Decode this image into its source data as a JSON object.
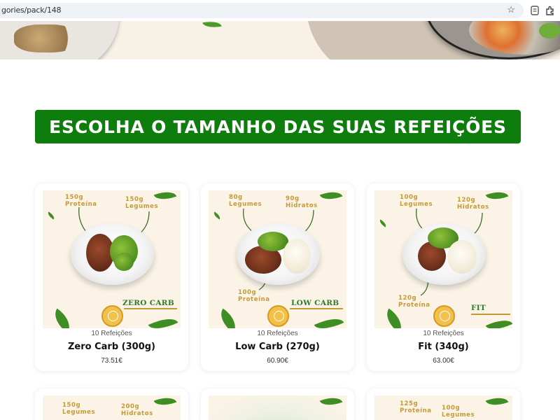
{
  "browser": {
    "url": "gories/pack/148",
    "icons": [
      "star-icon",
      "reader-mode-icon",
      "extensions-icon"
    ]
  },
  "section": {
    "title": "ESCOLHA O TAMANHO DAS SUAS REFEIÇÕES"
  },
  "colors": {
    "brand_green": "#0d7d0d",
    "label_gold": "#c59a36"
  },
  "products": [
    {
      "count": "10 Refeições",
      "name": "Zero Carb (300g)",
      "price": "73.51€",
      "image": {
        "labels": [
          "150g Proteína",
          "150g Legumes"
        ],
        "brand": "ZERO CARB"
      }
    },
    {
      "count": "10 Refeições",
      "name": "Low Carb (270g)",
      "price": "60.90€",
      "image": {
        "labels": [
          "80g Legumes",
          "90g Hidratos",
          "100g Proteína"
        ],
        "brand": "LOW CARB"
      }
    },
    {
      "count": "10 Refeições",
      "name": "Fit (340g)",
      "price": "63.00€",
      "image": {
        "labels": [
          "100g Legumes",
          "120g Hidratos",
          "120g Proteína"
        ],
        "brand": "FIT"
      }
    }
  ],
  "products_row2": [
    {
      "image": {
        "labels": [
          "150g Legumes",
          "200g Hidratos"
        ]
      }
    },
    {
      "image": {
        "labels": []
      }
    },
    {
      "image": {
        "labels": [
          "125g Proteína",
          "100g Legumes"
        ]
      }
    }
  ]
}
